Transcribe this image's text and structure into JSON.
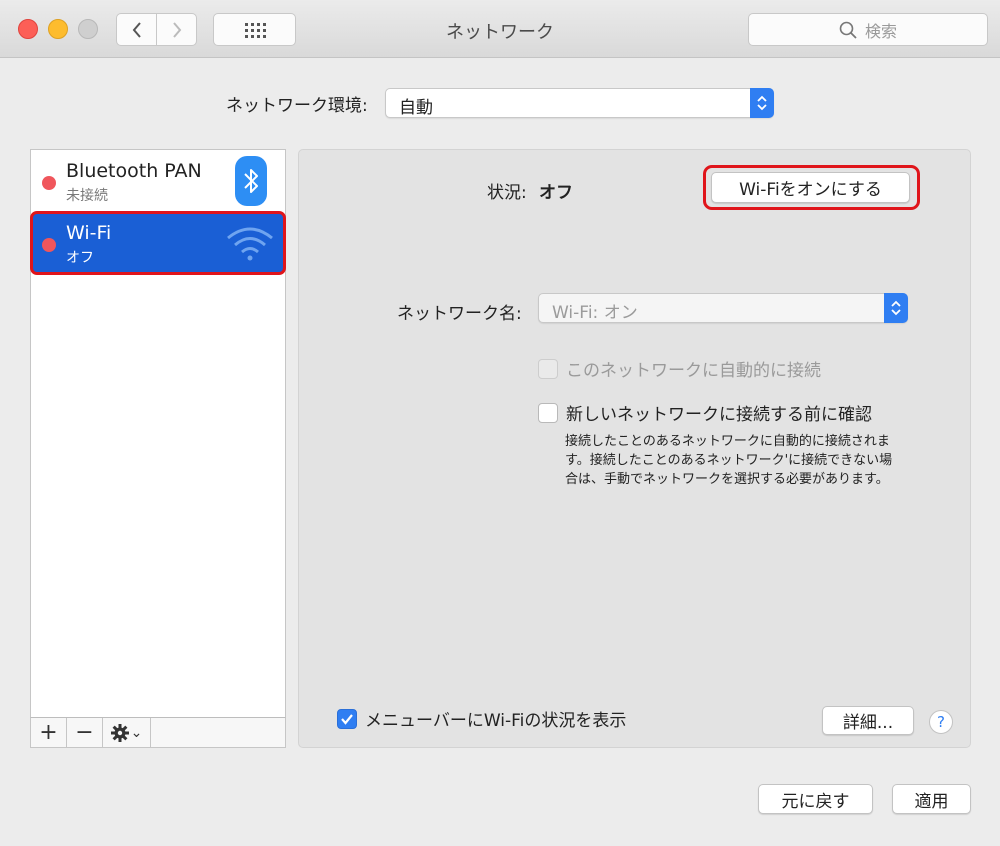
{
  "window": {
    "title": "ネットワーク"
  },
  "search": {
    "placeholder": "検索"
  },
  "location": {
    "label": "ネットワーク環境:",
    "value": "自動"
  },
  "services": [
    {
      "name": "Bluetooth PAN",
      "status": "未接続"
    },
    {
      "name": "Wi-Fi",
      "status": "オフ"
    }
  ],
  "sidebar_toolbar": {
    "add": "+",
    "remove": "−",
    "gear_arrow": "⌄"
  },
  "detail": {
    "status_label": "状況:",
    "status_value": "オフ",
    "toggle_button": "Wi-Fiをオンにする",
    "network_name_label": "ネットワーク名:",
    "network_name_value": "Wi-Fi: オン",
    "auto_join_label": "このネットワークに自動的に接続",
    "ask_join_label": "新しいネットワークに接続する前に確認",
    "help_text": "接続したことのあるネットワークに自動的に接続されます。接続したことのあるネットワーク'に接続できない場合は、手動でネットワークを選択する必要があります。",
    "show_in_menubar_label": "メニューバーにWi-Fiの状況を表示",
    "advanced_button": "詳細...",
    "help_button": "?"
  },
  "footer": {
    "revert_button": "元に戻す",
    "apply_button": "適用"
  },
  "colors": {
    "accent": "#2f7ef2",
    "selection": "#1a5fd5",
    "highlight": "#e0151b",
    "status_dot": "#f0565c"
  }
}
